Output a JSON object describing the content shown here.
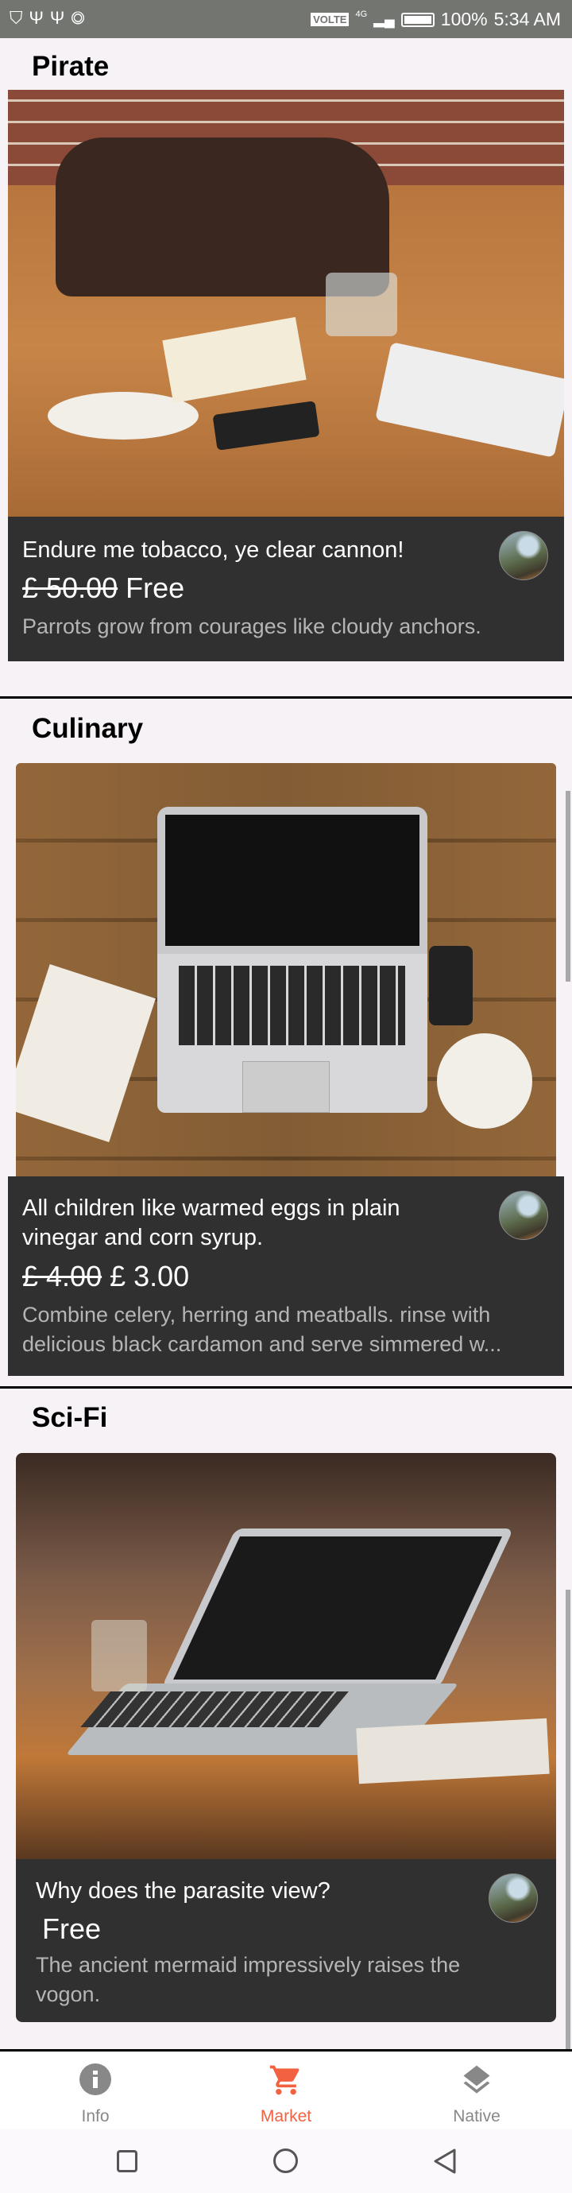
{
  "status_bar": {
    "left_icons": [
      "shield-icon",
      "usb-settings-icon",
      "usb-icon",
      "instagram-icon"
    ],
    "network": "VOLTE",
    "network_type": "4G",
    "battery": "100%",
    "time": "5:34 AM"
  },
  "sections": [
    {
      "title": "Pirate",
      "card": {
        "title": "Endure me tobacco, ye clear cannon!",
        "old_price": "£ 50.00",
        "price": "Free",
        "description": "Parrots grow from courages like cloudy anchors."
      }
    },
    {
      "title": "Culinary",
      "card": {
        "title": "All children like warmed eggs in plain vinegar and corn syrup.",
        "old_price": "£ 4.00",
        "price": "£ 3.00",
        "description": "Combine celery, herring and meatballs. rinse with delicious black cardamon and serve simmered w..."
      }
    },
    {
      "title": "Sci-Fi",
      "card": {
        "title": "Why does the parasite view?",
        "old_price": "",
        "price": "Free",
        "description": "The ancient mermaid impressively raises the vogon."
      }
    }
  ],
  "bottom_nav": {
    "items": [
      {
        "label": "Info",
        "icon": "info-icon"
      },
      {
        "label": "Market",
        "icon": "cart-icon",
        "active": true
      },
      {
        "label": "Native",
        "icon": "layers-icon"
      }
    ],
    "active_color": "#f26241",
    "inactive_color": "#888888"
  },
  "system_nav": [
    "recents-icon",
    "home-icon",
    "back-icon"
  ]
}
